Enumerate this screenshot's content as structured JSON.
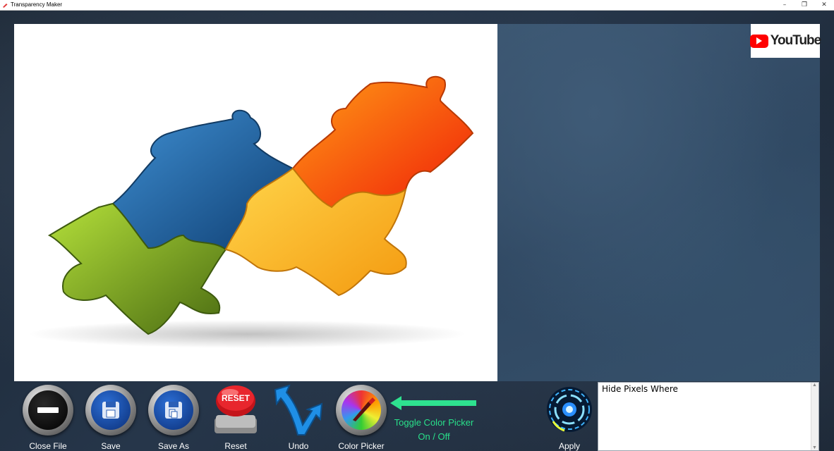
{
  "window": {
    "title": "Transparency Maker",
    "minimize_symbol": "–",
    "restore_symbol": "❐",
    "close_symbol": "✕"
  },
  "badge": {
    "youtube_text": "YouTube"
  },
  "toolbar": {
    "close_file": "Close File",
    "save": "Save",
    "save_as": "Save As",
    "reset": "Reset",
    "reset_cap": "RESET",
    "undo": "Undo",
    "color_picker": "Color Picker",
    "apply": "Apply"
  },
  "toggle_hint": {
    "line1": "Toggle Color Picker",
    "line2": "On / Off"
  },
  "hide_panel": {
    "text": "Hide Pixels Where"
  },
  "colors": {
    "hint_green": "#29e08a",
    "arrow_green": "#2ee28f"
  }
}
